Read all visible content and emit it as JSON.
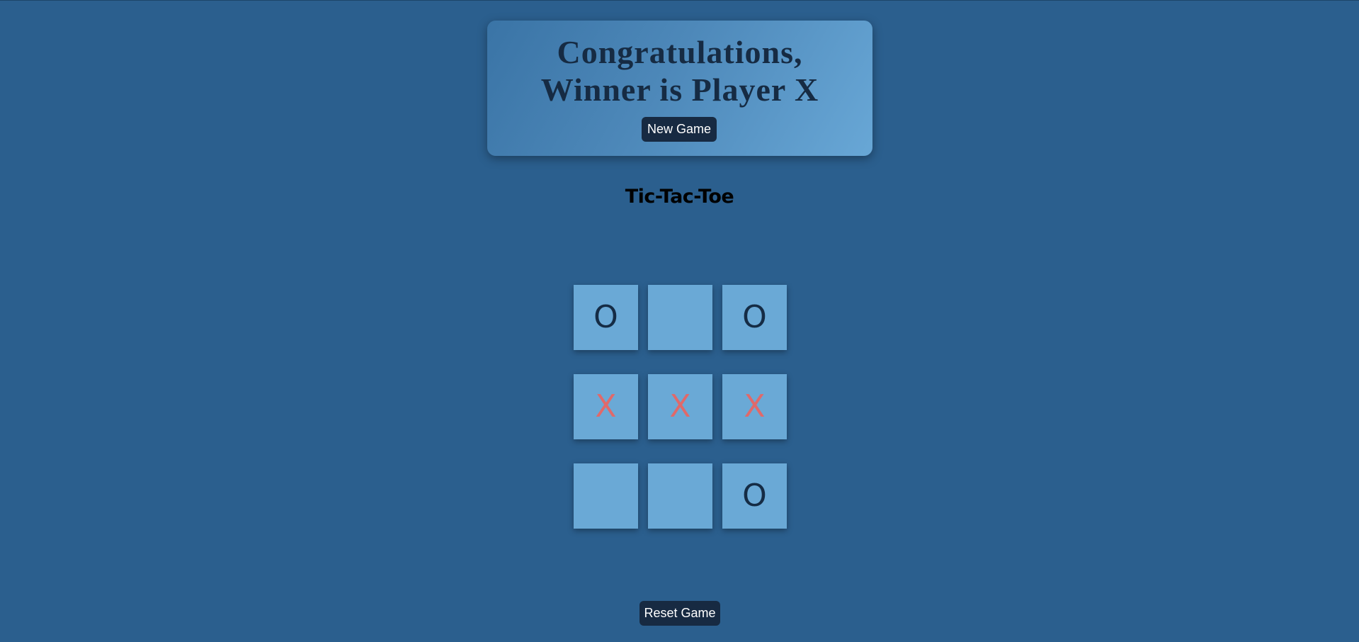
{
  "winner_banner": {
    "message_line1": "Congratulations,",
    "message_line2": "Winner is Player X",
    "new_game_label": "New Game"
  },
  "game": {
    "title": "Tic-Tac-Toe",
    "board": [
      "O",
      "",
      "O",
      "X",
      "X",
      "X",
      "",
      "",
      "O"
    ],
    "reset_label": "Reset Game"
  },
  "colors": {
    "background": "#2b5f8e",
    "cell": "#6aa9d6",
    "button": "#172a42",
    "mark_o": "#152c45",
    "mark_x": "#e0696a"
  }
}
